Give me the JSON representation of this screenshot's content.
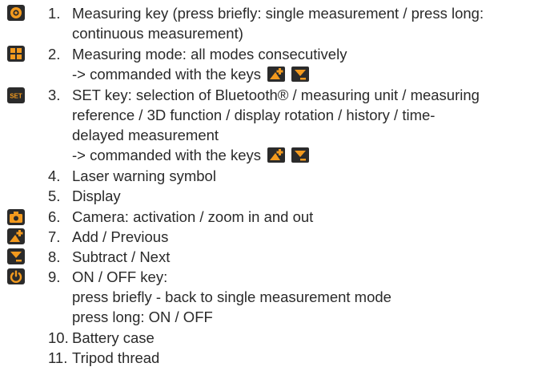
{
  "items": [
    {
      "number": "1.",
      "lines": [
        "Measuring key (press briefly: single measurement / press long:",
        "continuous measurement)"
      ]
    },
    {
      "number": "2.",
      "lines": [
        "Measuring mode: all modes consecutively"
      ],
      "arrow_text": "-> commanded with the keys"
    },
    {
      "number": "3.",
      "lines": [
        "SET key: selection of Bluetooth® / measuring unit / measuring",
        "reference / 3D function / display rotation / history / time-",
        "delayed measurement"
      ],
      "arrow_text": "-> commanded with the keys"
    },
    {
      "number": "4.",
      "lines": [
        "Laser warning symbol"
      ]
    },
    {
      "number": "5.",
      "lines": [
        "Display"
      ]
    },
    {
      "number": "6.",
      "lines": [
        "Camera: activation  / zoom in and out"
      ]
    },
    {
      "number": "7.",
      "lines": [
        "Add / Previous"
      ]
    },
    {
      "number": "8.",
      "lines": [
        "Subtract / Next"
      ]
    },
    {
      "number": "9.",
      "lines": [
        "ON / OFF key:",
        "press briefly - back to single measurement mode",
        "press long: ON / OFF"
      ]
    },
    {
      "number": "10.",
      "lines": [
        "Battery case"
      ]
    },
    {
      "number": "11.",
      "lines": [
        "Tripod thread"
      ]
    }
  ],
  "icons": {
    "item1": "measure-key-icon",
    "item2": "measuring-mode-icon",
    "item3": "set-key-icon",
    "item6": "camera-icon",
    "item7": "add-previous-icon",
    "item8": "subtract-next-icon",
    "item9": "power-icon"
  },
  "colors": {
    "icon_background": "#2b2b2b",
    "icon_accent": "#f39a1e",
    "text": "#2a2a2a"
  }
}
